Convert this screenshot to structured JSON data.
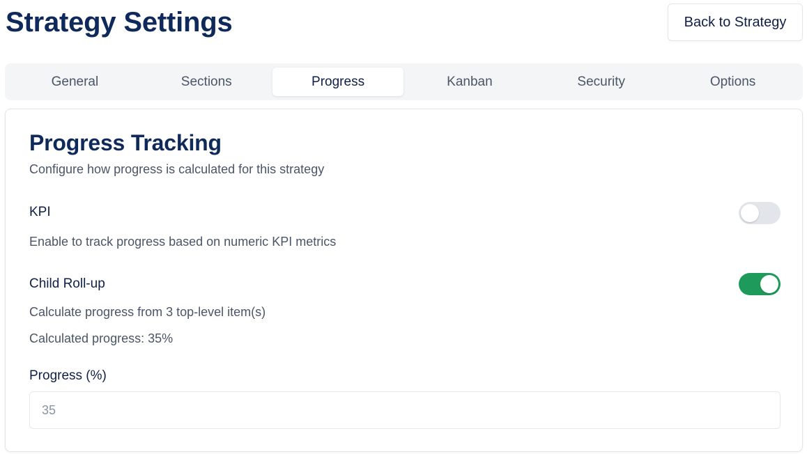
{
  "header": {
    "title": "Strategy Settings",
    "back_label": "Back to Strategy"
  },
  "tabs": [
    {
      "label": "General",
      "active": false
    },
    {
      "label": "Sections",
      "active": false
    },
    {
      "label": "Progress",
      "active": true
    },
    {
      "label": "Kanban",
      "active": false
    },
    {
      "label": "Security",
      "active": false
    },
    {
      "label": "Options",
      "active": false
    }
  ],
  "panel": {
    "title": "Progress Tracking",
    "subtitle": "Configure how progress is calculated for this strategy",
    "kpi": {
      "label": "KPI",
      "description": "Enable to track progress based on numeric KPI metrics",
      "enabled": false
    },
    "child_rollup": {
      "label": "Child Roll-up",
      "description": "Calculate progress from 3 top-level item(s)",
      "calculated": "Calculated progress: 35%",
      "enabled": true
    },
    "progress_field": {
      "label": "Progress (%)",
      "value": "35"
    }
  },
  "colors": {
    "toggle_on": "#1e9b5a",
    "toggle_off": "#e2e5ea",
    "heading": "#0f2a5a"
  }
}
